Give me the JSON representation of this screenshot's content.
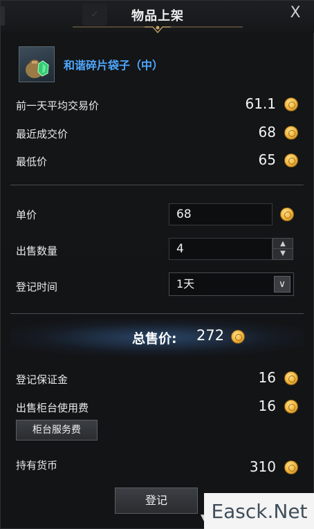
{
  "dialog": {
    "title": "物品上架",
    "close_glyph": "X"
  },
  "item": {
    "name": "和谐碎片袋子（中）",
    "icon": "pouch-with-green-crystal-icon"
  },
  "prices": {
    "avg_prev_day_label": "前一天平均交易价",
    "avg_prev_day_value": "61.1",
    "recent_deal_label": "最近成交价",
    "recent_deal_value": "68",
    "lowest_label": "最低价",
    "lowest_value": "65"
  },
  "form": {
    "unit_price_label": "单价",
    "unit_price_value": "68",
    "quantity_label": "出售数量",
    "quantity_value": "4",
    "duration_label": "登记时间",
    "duration_value": "1天"
  },
  "total": {
    "label": "总售价:",
    "value": "272"
  },
  "fees": {
    "deposit_label": "登记保证金",
    "deposit_value": "16",
    "counter_fee_label": "出售柜台使用费",
    "counter_fee_value": "16",
    "service_button_label": "柜台服务费",
    "held_currency_label": "持有货币",
    "held_currency_value": "310"
  },
  "actions": {
    "register_label": "登记"
  },
  "watermark": {
    "text": "Easck.Net"
  },
  "colors": {
    "item_name": "#4ea8ff",
    "coin": "#f0b43a"
  }
}
